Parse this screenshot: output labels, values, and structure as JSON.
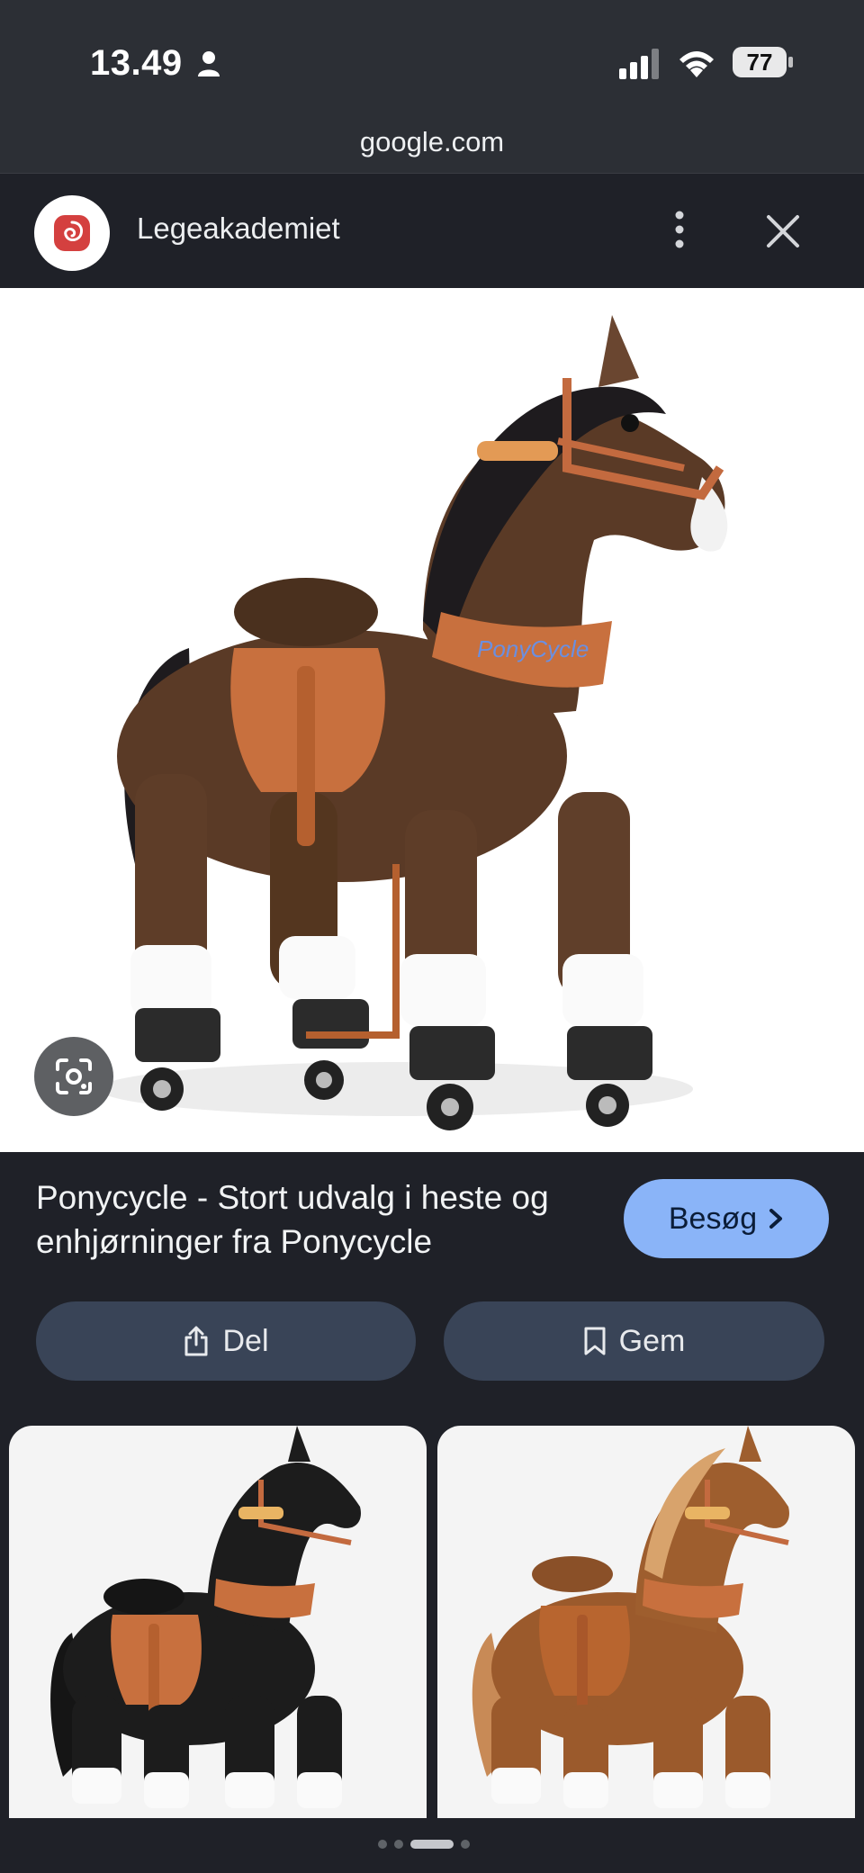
{
  "status_bar": {
    "time": "13.49",
    "battery": "77",
    "icons": [
      "person-icon",
      "cellular-signal-icon",
      "wifi-icon",
      "battery-icon"
    ]
  },
  "url": "google.com",
  "header": {
    "site_name": "Legeakademiet",
    "icons": [
      "site-logo",
      "more-vert-icon",
      "close-icon"
    ]
  },
  "main_image": {
    "subject": "brown plush ride-on horse on wheels",
    "brand_text": "PonyCycle",
    "icons": [
      "lens-icon"
    ]
  },
  "result": {
    "title": "Ponycycle - Stort udvalg i heste og enhjørninger fra Ponycycle",
    "visit_label": "Besøg",
    "share_label": "Del",
    "save_label": "Gem"
  },
  "thumbnails": [
    {
      "subject": "black plush ride-on horse"
    },
    {
      "subject": "light brown plush ride-on horse"
    }
  ],
  "colors": {
    "background": "#1f2128",
    "status_bar": "#2c2f35",
    "visit_button": "#8ab4f8",
    "action_button": "#394457"
  }
}
